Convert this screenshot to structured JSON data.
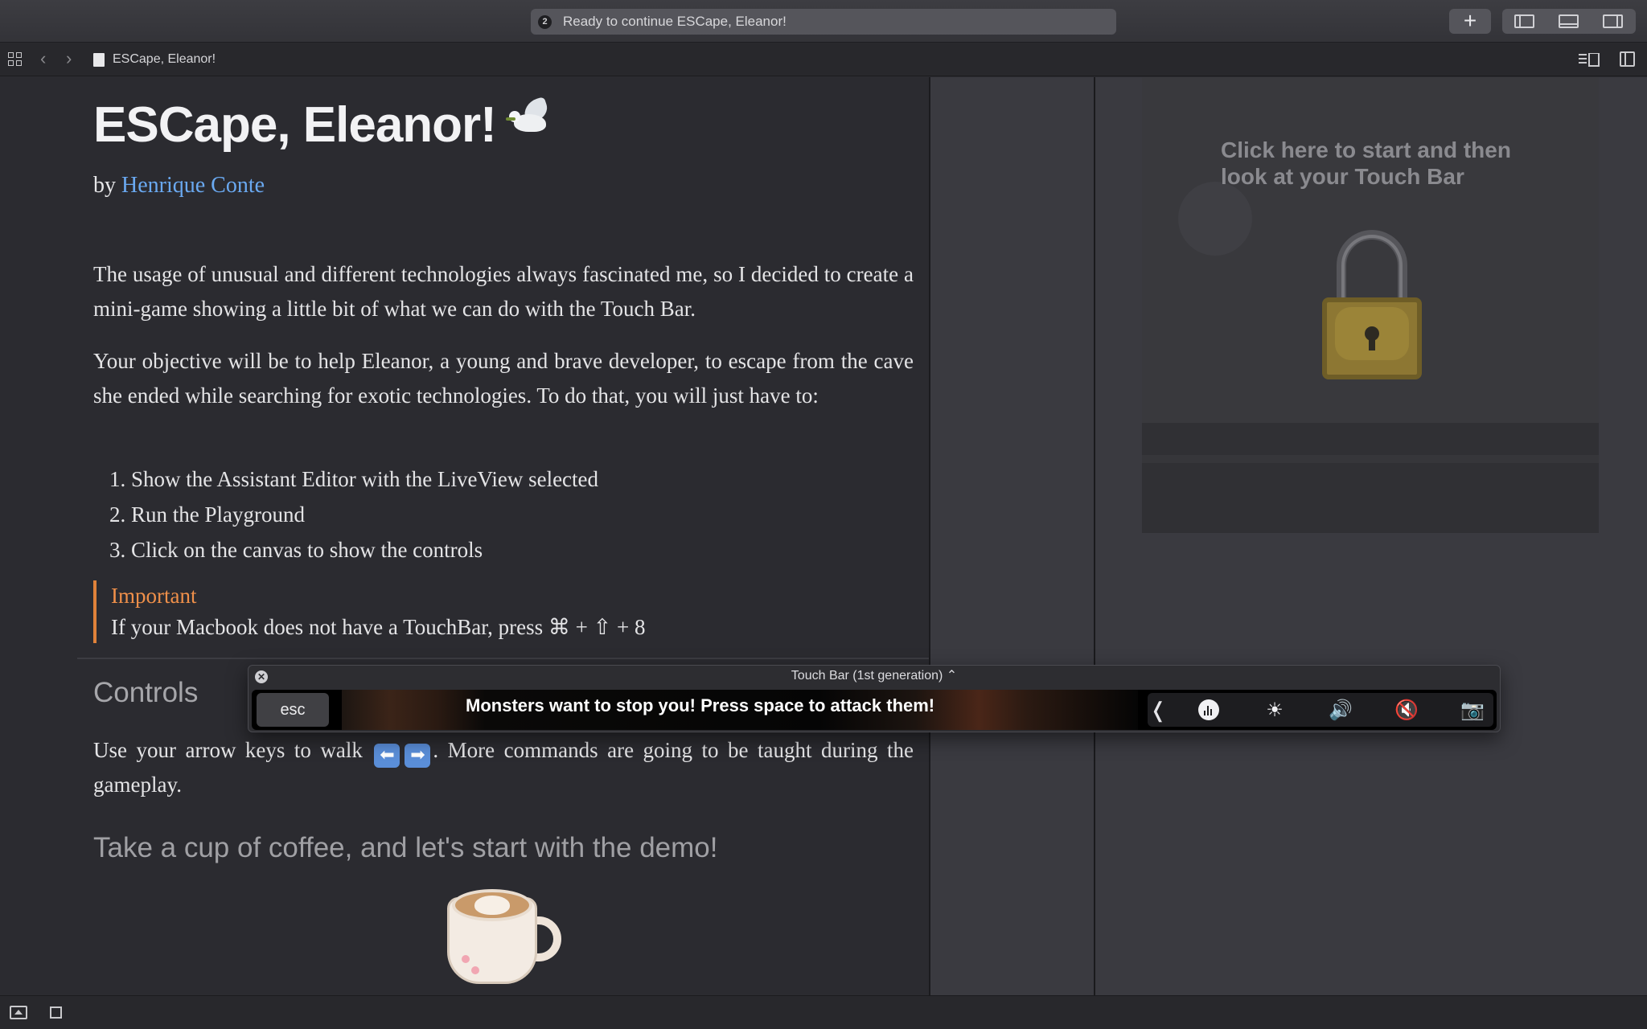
{
  "window": {
    "activity_badge": "2",
    "activity_text": "Ready to continue ESCape, Eleanor!",
    "add_label": "+"
  },
  "jumpbar": {
    "back_icon": "‹",
    "forward_icon": "›",
    "file_name": "ESCape, Eleanor!"
  },
  "doc": {
    "title": "ESCape, Eleanor!",
    "by_prefix": "by",
    "author": "Henrique Conte",
    "paragraph1": "The usage of unusual and different technologies always fascinated me, so I decided to create a mini-game showing a little bit of what we can do with the Touch Bar.",
    "paragraph2": "Your objective will be to help Eleanor, a young and brave developer, to escape from the cave she ended while searching for exotic technologies. To do that, you will just have to:",
    "steps": [
      "1.  Show the Assistant Editor with the LiveView selected",
      "2.  Run the Playground",
      "3.  Click on the canvas to show the controls"
    ],
    "callout_title": "Important",
    "callout_text": "If your Macbook does not have a TouchBar, press ⌘ + ⇧ + 8",
    "controls_heading": "Controls",
    "controls_text_a": "Use your arrow keys to walk",
    "key_left": "⬅",
    "key_right": "➡",
    "controls_text_b": ". More commands are going to be taught during the gameplay.",
    "coffee_heading": "Take a cup of coffee, and let's start with the demo!"
  },
  "liveview": {
    "prompt": "Click here to start and then look at your Touch Bar"
  },
  "touchbar": {
    "window_title": "Touch Bar (1st generation) ⌃",
    "close_icon": "✕",
    "esc_label": "esc",
    "message": "Monsters want to stop you! Press space to attack them!",
    "collapse_icon": "❬",
    "brightness_icon": "☀",
    "volume_icon": "🔊",
    "mute_icon": "🔇",
    "screenshot_icon": "📷"
  },
  "colors": {
    "link": "#6aa9f1",
    "callout_accent": "#e0823a",
    "background": "#2b2b30"
  }
}
